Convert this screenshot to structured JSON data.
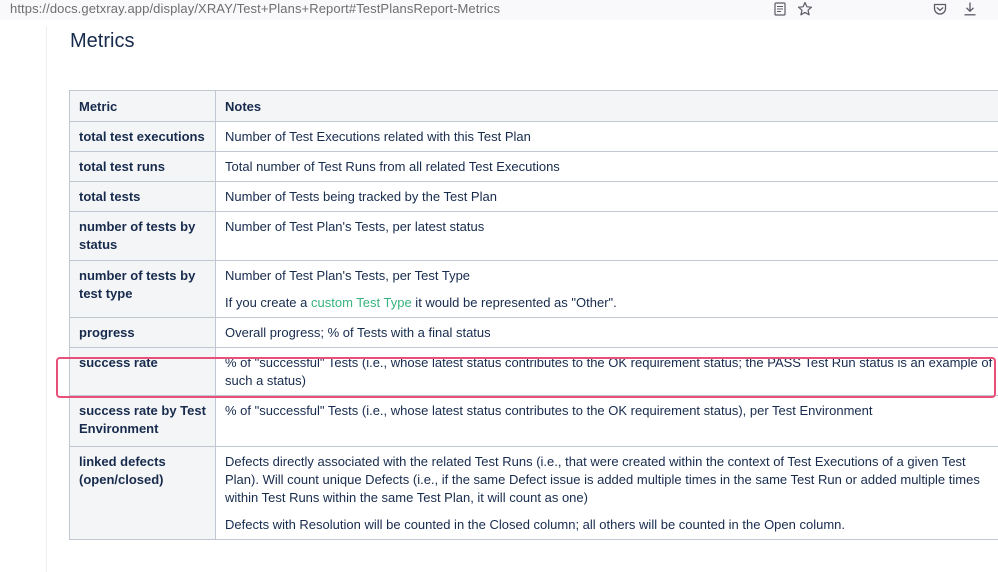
{
  "browser": {
    "url": "https://docs.getxray.app/display/XRAY/Test+Plans+Report#TestPlansReport-Metrics",
    "icons": [
      "reader-view-icon",
      "bookmark-star-icon",
      "pocket-icon",
      "downloads-icon"
    ]
  },
  "page": {
    "title": "Metrics"
  },
  "table": {
    "headers": {
      "metric": "Metric",
      "notes": "Notes"
    },
    "rows": [
      {
        "metric": "total test executions",
        "notes": [
          "Number of Test Executions related with this Test Plan"
        ]
      },
      {
        "metric": "total test runs",
        "notes": [
          "Total number of Test Runs from all related Test Executions"
        ]
      },
      {
        "metric": "total tests",
        "notes": [
          "Number of Tests being tracked by the Test Plan"
        ]
      },
      {
        "metric": "number of tests by status",
        "notes": [
          "Number of Test Plan's Tests, per latest status"
        ]
      },
      {
        "metric": "number of tests by test type",
        "notes": [
          "Number of Test Plan's Tests, per Test Type"
        ],
        "note2": {
          "before": "If you create a ",
          "link": "custom Test Type",
          "after": " it would be represented as \"Other\"."
        }
      },
      {
        "metric": "progress",
        "notes": [
          "Overall progress; % of Tests with a final status"
        ]
      },
      {
        "metric": "success rate",
        "notes": [
          "% of \"successful\" Tests (i.e., whose latest status contributes to the OK requirement status; the PASS Test Run status is an example of such a status)"
        ]
      },
      {
        "metric": "success rate by Test Environment",
        "notes": [
          "% of \"successful\" Tests (i.e., whose latest status contributes to the OK requirement status), per Test Environment"
        ]
      },
      {
        "metric": "linked defects (open/closed)",
        "notes": [
          "Defects directly associated with the related Test Runs (i.e., that were created within the context of Test Executions of a given Test Plan). Will count unique Defects (i.e., if the same Defect issue is added multiple times in the same Test Run or added multiple times within Test Runs within the same Test Plan, it will count as one)",
          "Defects with Resolution will be counted in the Closed column; all others will be counted in the Open column."
        ]
      }
    ]
  },
  "highlight": {
    "row_index": 6,
    "color": "#e8507a"
  },
  "colors": {
    "link": "#36b37e",
    "text": "#172b4d",
    "header_bg": "#f4f5f7",
    "border": "#c1c7d0"
  }
}
